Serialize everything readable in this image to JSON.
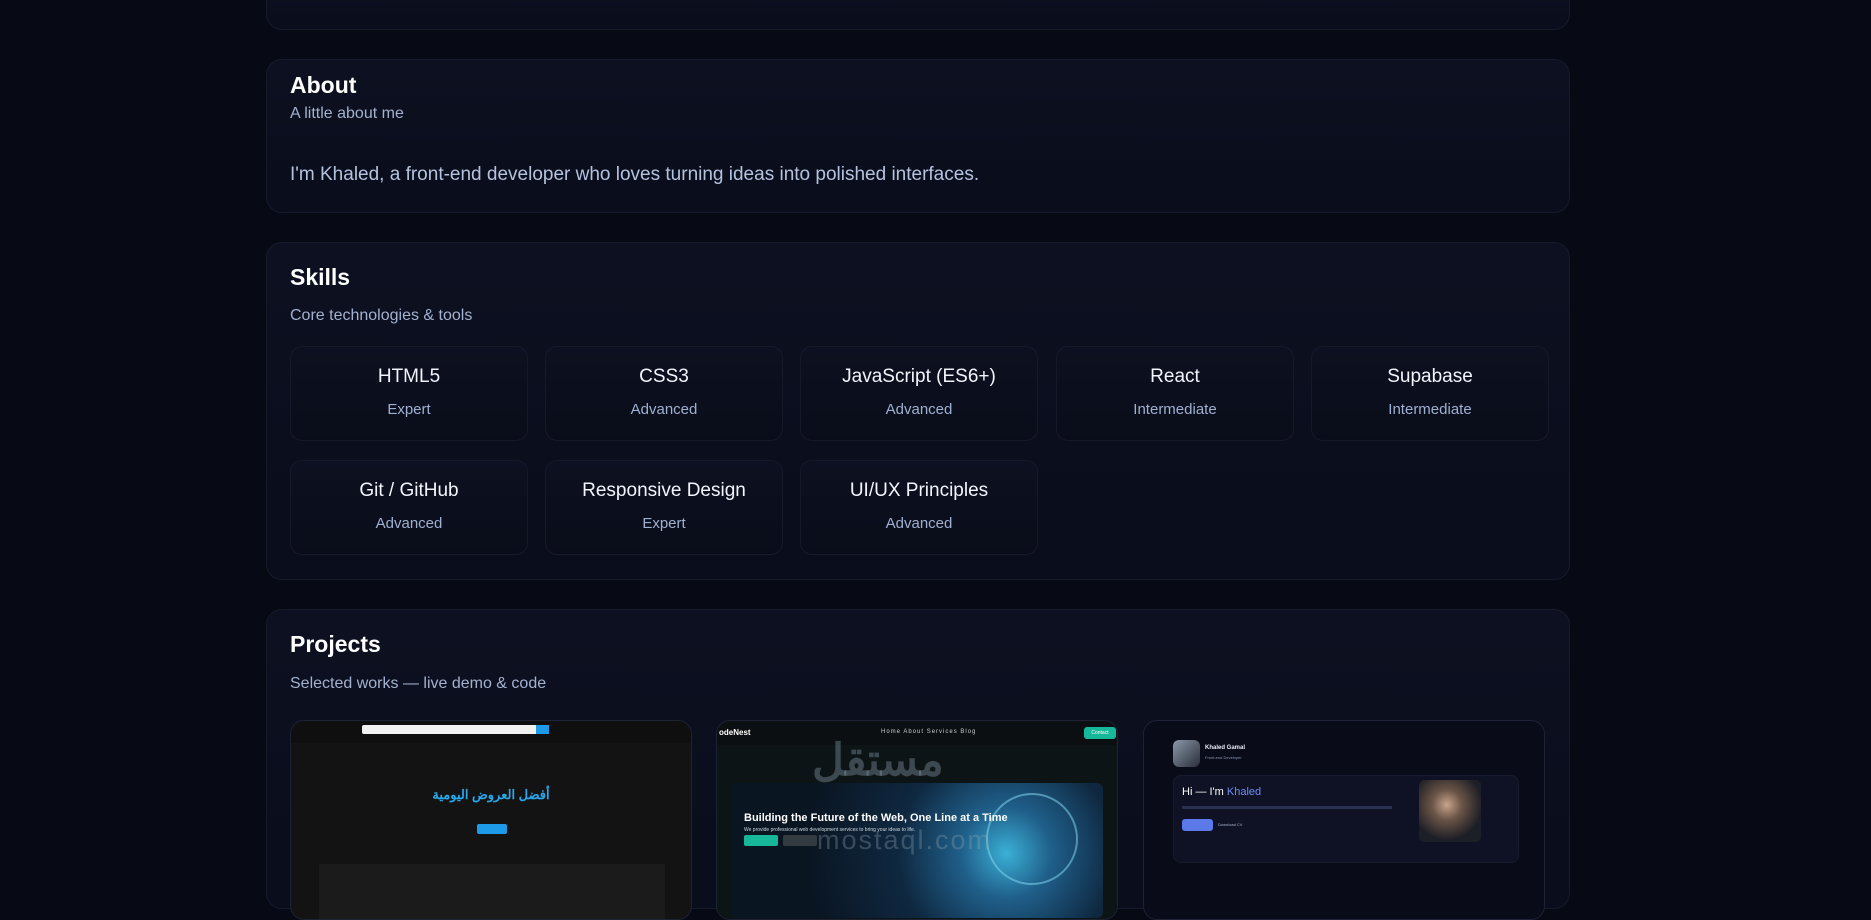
{
  "about": {
    "title": "About",
    "subtitle": "A little about me",
    "text": "I'm Khaled, a front-end developer who loves turning ideas into polished interfaces."
  },
  "skills": {
    "title": "Skills",
    "subtitle": "Core technologies & tools",
    "items": [
      {
        "name": "HTML5",
        "level": "Expert"
      },
      {
        "name": "CSS3",
        "level": "Advanced"
      },
      {
        "name": "JavaScript (ES6+)",
        "level": "Advanced"
      },
      {
        "name": "React",
        "level": "Intermediate"
      },
      {
        "name": "Supabase",
        "level": "Intermediate"
      },
      {
        "name": "Git / GitHub",
        "level": "Advanced"
      },
      {
        "name": "Responsive Design",
        "level": "Expert"
      },
      {
        "name": "UI/UX Principles",
        "level": "Advanced"
      }
    ]
  },
  "projects": {
    "title": "Projects",
    "subtitle": "Selected works — live demo & code",
    "thumbs": [
      {
        "hero": "أفضل العروض اليومية"
      },
      {
        "logo": "odeNest",
        "menu": "Home  About  Services  Blog",
        "contact": "Contact",
        "headline": "Building the Future of the Web, One Line at a Time",
        "desc": "We provide professional web development services to bring your ideas to life.",
        "watermark": "مستقل",
        "watermark_sub": "mostaql.com"
      },
      {
        "name": "Khaled Gamal",
        "role": "Front-end Developer",
        "hi_prefix": "Hi — I'm ",
        "hi_name": "Khaled",
        "secondary": "Download CV"
      }
    ]
  },
  "colors": {
    "background": "#070a15",
    "accent": "#6f8cf5",
    "muted_text": "#a4b1cf"
  }
}
